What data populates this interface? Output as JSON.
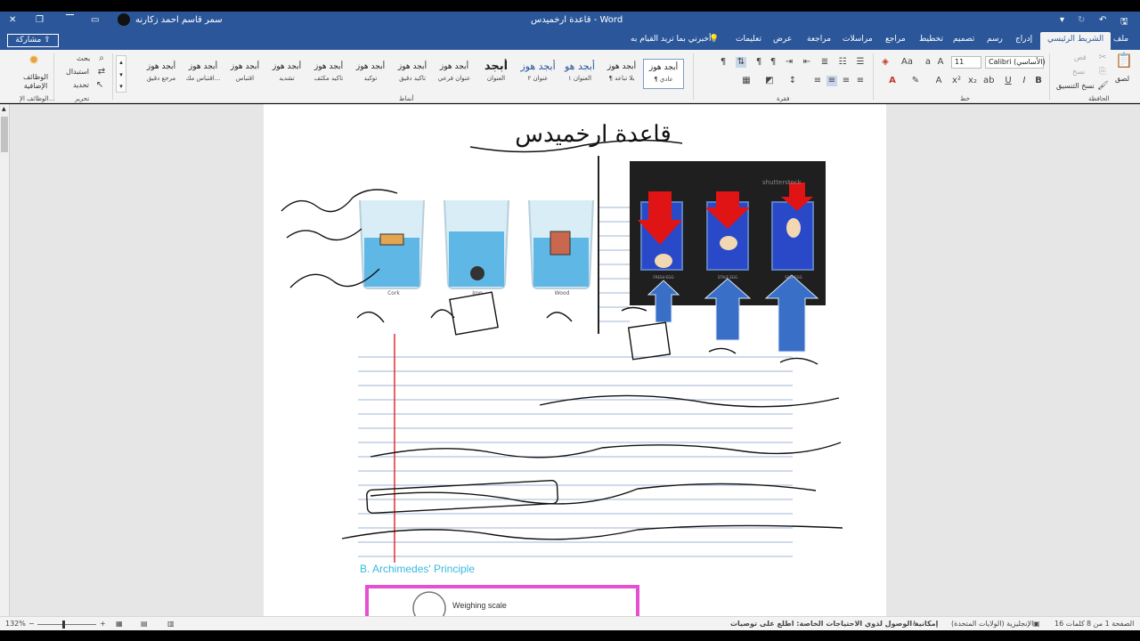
{
  "titlebar": {
    "document_title": "قاعدة ارخميدس  -  Word",
    "user_name": "سمر قاسم احمد زكارنه"
  },
  "tabs": [
    {
      "label": "ملف"
    },
    {
      "label": "الشريط الرئيسي"
    },
    {
      "label": "إدراج"
    },
    {
      "label": "رسم"
    },
    {
      "label": "تصميم"
    },
    {
      "label": "تخطيط"
    },
    {
      "label": "مراجع"
    },
    {
      "label": "مراسلات"
    },
    {
      "label": "مراجعة"
    },
    {
      "label": "عرض"
    },
    {
      "label": "تعليمات"
    }
  ],
  "tell_me": "أخبرني بما تريد القيام به",
  "share_label": "مشاركة",
  "ribbon": {
    "clipboard": {
      "paste": "لصق",
      "cut": "قص",
      "copy": "نسخ",
      "format_painter": "نسخ التنسيق",
      "label": "الحافظة"
    },
    "font": {
      "name": "Calibri (الأساسي)",
      "size": "11",
      "label": "خط"
    },
    "paragraph": {
      "label": "فقرة"
    },
    "styles": {
      "label": "أنماط",
      "items": [
        {
          "sample": "أبجد هوز",
          "name": "¶ عادي"
        },
        {
          "sample": "أبجد هوز",
          "name": "¶ بلا تباعد"
        },
        {
          "sample": "أبجد هو",
          "name": "العنوان ١"
        },
        {
          "sample": "أبجد هوز",
          "name": "عنوان ٢"
        },
        {
          "sample": "أبجد",
          "name": "العنوان"
        },
        {
          "sample": "أبجد هوز",
          "name": "عنوان فرعي"
        },
        {
          "sample": "أبجد هوز",
          "name": "تأكيد دقيق"
        },
        {
          "sample": "أبجد هوز",
          "name": "توكيد"
        },
        {
          "sample": "أبجد هوز",
          "name": "تأكيد مكثف"
        },
        {
          "sample": "أبجد هوز",
          "name": "تشديد"
        },
        {
          "sample": "أبجد هوز",
          "name": "اقتباس"
        },
        {
          "sample": "أبجد هوز",
          "name": "اقتباس مك..."
        },
        {
          "sample": "أبجد هوز",
          "name": "مرجع دقيق"
        }
      ]
    },
    "editing": {
      "find": "بحث",
      "replace": "استبدال",
      "select": "تحديد",
      "label": "تحرير"
    },
    "addins": {
      "button": "الوظائف الإضافية",
      "label": "الوظائف الإ..."
    }
  },
  "document": {
    "handwritten_title": "قاعدة ارخميدس",
    "image1_labels": {
      "cork": "Cork",
      "iron": "Iron",
      "wood": "Wood"
    },
    "image2_watermark": "shutterstock",
    "image2_labels": {
      "fresh": "FRESH EGG",
      "stale": "STALE EGG",
      "salt": "SALT EGG"
    },
    "bottom_heading": "B. Archimedes' Principle",
    "weighing_scale": "Weighing scale"
  },
  "statusbar": {
    "page": "الصفحة 1 من 8",
    "words": "16 كلمات",
    "language": "الإنجليزية (الولايات المتحدة)",
    "accessibility": "إمكانية الوصول لذوي الاحتياجات الخاصة: اطلع على توصيات",
    "zoom": "132%"
  },
  "colors": {
    "word_blue": "#2b579a",
    "ribbon_bg": "#f3f3f3",
    "workspace_bg": "#e6e6e6",
    "margin_red": "#e03030",
    "rule_blue": "#9fb4d6"
  }
}
